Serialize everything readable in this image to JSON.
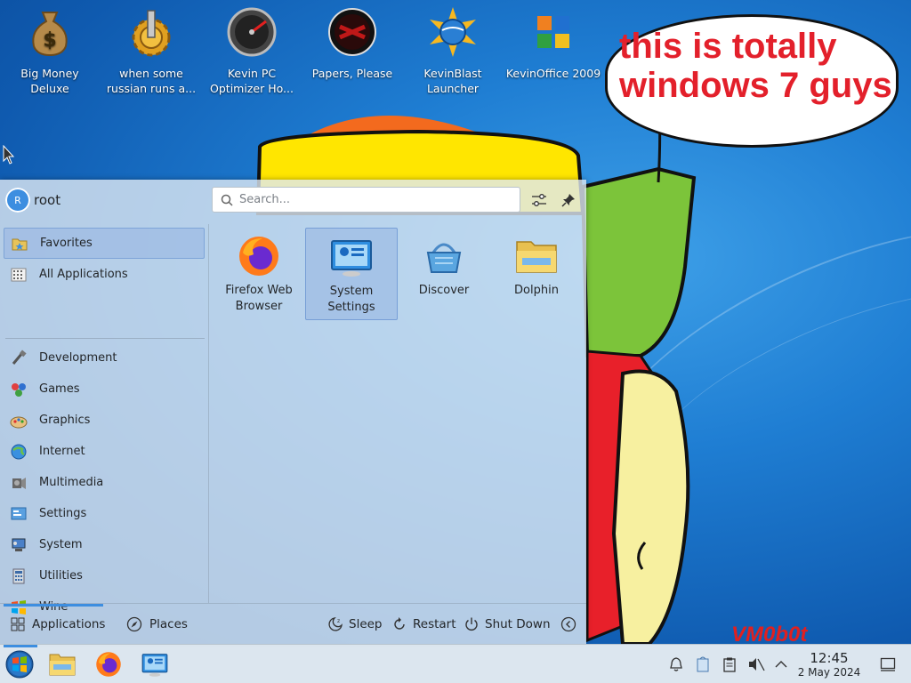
{
  "desktop": {
    "icons": [
      {
        "label": "Big Money Deluxe",
        "icon": "money-bag-icon"
      },
      {
        "label": "when some russian runs a...",
        "icon": "gear-icon"
      },
      {
        "label": "Kevin PC Optimizer Ho...",
        "icon": "speedometer-icon"
      },
      {
        "label": "Papers, Please",
        "icon": "emblem-icon"
      },
      {
        "label": "KevinBlast Launcher",
        "icon": "globe-icon"
      },
      {
        "label": "KevinOffice 2009",
        "icon": "office-logo-icon"
      }
    ],
    "bubble_text": "this is totally windows 7 guys",
    "watermark": "VM0b0t"
  },
  "menu": {
    "user": "root",
    "avatar_initial": "R",
    "search_placeholder": "Search...",
    "categories": [
      {
        "label": "Favorites",
        "icon": "favorites-folder-icon"
      },
      {
        "label": "All Applications",
        "icon": "grid-list-icon"
      },
      {
        "label": "Development",
        "icon": "development-icon"
      },
      {
        "label": "Games",
        "icon": "games-icon"
      },
      {
        "label": "Graphics",
        "icon": "graphics-icon"
      },
      {
        "label": "Internet",
        "icon": "internet-globe-icon"
      },
      {
        "label": "Multimedia",
        "icon": "multimedia-icon"
      },
      {
        "label": "Settings",
        "icon": "settings-panel-icon"
      },
      {
        "label": "System",
        "icon": "system-icon"
      },
      {
        "label": "Utilities",
        "icon": "utilities-icon"
      },
      {
        "label": "Wine",
        "icon": "wine-windows-flag-icon"
      }
    ],
    "favorites": [
      {
        "label": "Firefox Web Browser",
        "icon": "firefox-icon"
      },
      {
        "label": "System Settings",
        "icon": "system-settings-icon"
      },
      {
        "label": "Discover",
        "icon": "discover-basket-icon"
      },
      {
        "label": "Dolphin",
        "icon": "dolphin-folder-icon"
      }
    ],
    "footer": {
      "applications": "Applications",
      "places": "Places",
      "sleep": "Sleep",
      "restart": "Restart",
      "shutdown": "Shut Down"
    }
  },
  "taskbar": {
    "time": "12:45",
    "date": "2 May 2024"
  },
  "colors": {
    "accent": "#3d8ee0",
    "bubble_text": "#e3202b",
    "desktop_blue": "#1f7ed3"
  }
}
